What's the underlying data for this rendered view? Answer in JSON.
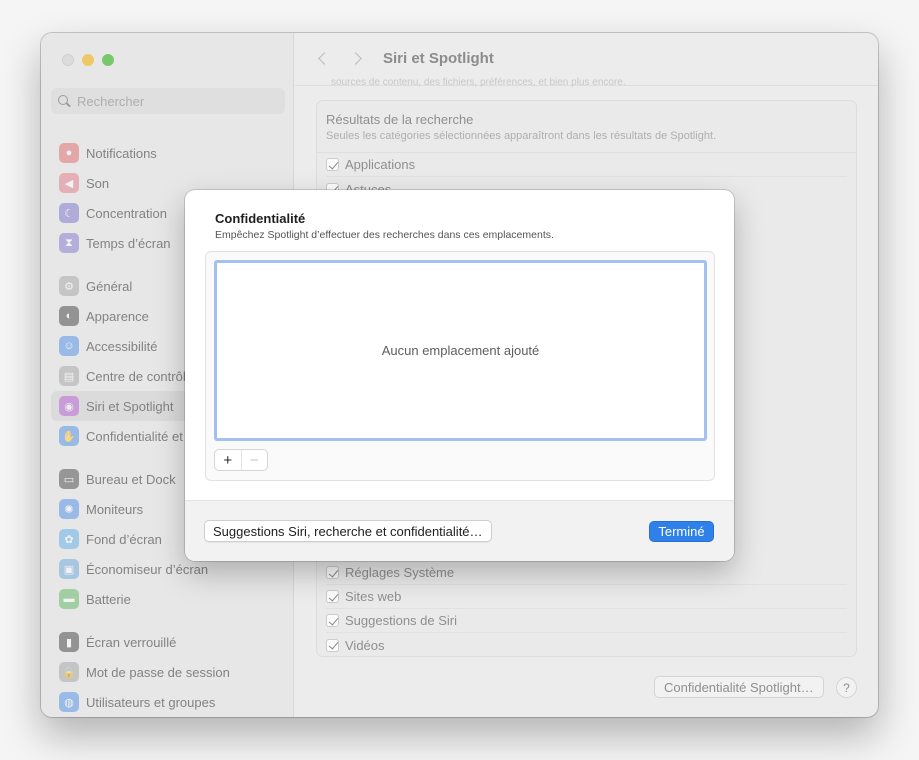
{
  "window": {
    "title": "Siri et Spotlight",
    "search_placeholder": "Rechercher",
    "faded_top_text": "sources de contenu, des fichiers, préférences, et bien plus encore."
  },
  "sidebar": {
    "groups": [
      [
        {
          "label": "Notifications",
          "icon": "bell-icon",
          "color": "#e05a5a"
        },
        {
          "label": "Son",
          "icon": "speaker-icon",
          "color": "#e06a7a"
        },
        {
          "label": "Concentration",
          "icon": "moon-icon",
          "color": "#6a64c8"
        },
        {
          "label": "Temps d’écran",
          "icon": "hourglass-icon",
          "color": "#7367c9"
        }
      ],
      [
        {
          "label": "Général",
          "icon": "gear-icon",
          "color": "#9a9a9a"
        },
        {
          "label": "Apparence",
          "icon": "appearance-icon",
          "color": "#2b2b2b"
        },
        {
          "label": "Accessibilité",
          "icon": "accessibility-icon",
          "color": "#3b82e6"
        },
        {
          "label": "Centre de contrôle",
          "icon": "control-center-icon",
          "color": "#9a9a9a"
        },
        {
          "label": "Siri et Spotlight",
          "icon": "siri-icon",
          "color": "#b04bd0",
          "selected": true
        },
        {
          "label": "Confidentialité et sécurité",
          "icon": "hand-icon",
          "color": "#3b82e6"
        }
      ],
      [
        {
          "label": "Bureau et Dock",
          "icon": "dock-icon",
          "color": "#333333"
        },
        {
          "label": "Moniteurs",
          "icon": "sun-icon",
          "color": "#3b82e6"
        },
        {
          "label": "Fond d’écran",
          "icon": "flower-icon",
          "color": "#4aa8e8"
        },
        {
          "label": "Économiseur d’écran",
          "icon": "screensaver-icon",
          "color": "#5aa0d8"
        },
        {
          "label": "Batterie",
          "icon": "battery-icon",
          "color": "#4caf50"
        }
      ],
      [
        {
          "label": "Écran verrouillé",
          "icon": "lock-screen-icon",
          "color": "#2b2b2b"
        },
        {
          "label": "Mot de passe de session",
          "icon": "lock-icon",
          "color": "#9a9a9a"
        },
        {
          "label": "Utilisateurs et groupes",
          "icon": "users-icon",
          "color": "#3b82e6"
        }
      ]
    ]
  },
  "panel": {
    "title": "Résultats de la recherche",
    "subtitle": "Seules les catégories sélectionnées apparaîtront dans les résultats de Spotlight.",
    "items_top": [
      "Applications",
      "Astuces"
    ],
    "items_bottom": [
      "Réglages Système",
      "Sites web",
      "Suggestions de Siri",
      "Vidéos"
    ],
    "privacy_button": "Confidentialité Spotlight…",
    "help_label": "?"
  },
  "sheet": {
    "title": "Confidentialité",
    "subtitle": "Empêchez Spotlight d’effectuer des recherches dans ces emplacements.",
    "empty_label": "Aucun emplacement ajouté",
    "plus_label": "+",
    "minus_label": "−",
    "suggestions_button": "Suggestions Siri, recherche et confidentialité…",
    "done_button": "Terminé"
  }
}
